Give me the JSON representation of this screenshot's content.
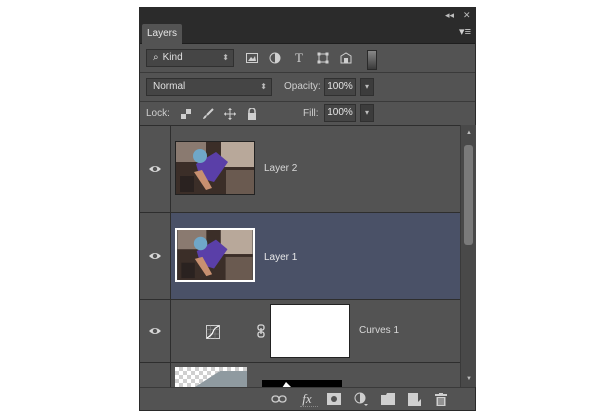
{
  "panel": {
    "tab_label": "Layers",
    "collapse_glyph": "◂◂",
    "close_glyph": "✕",
    "menu_glyph": "▾≡"
  },
  "filter": {
    "kind_label": "Kind",
    "search_glyph": "⌕",
    "arrow_glyph": "⬍",
    "filter_icons": [
      "image-filter-icon",
      "adjustment-filter-icon",
      "type-filter-icon",
      "shape-filter-icon",
      "smart-object-filter-icon",
      "filter-toggle-icon"
    ],
    "type_glyph": "T"
  },
  "blend": {
    "mode": "Normal",
    "arrow_glyph": "⬍",
    "opacity_label": "Opacity:",
    "opacity_value": "100%",
    "drop_glyph": "▾"
  },
  "lock": {
    "label": "Lock:",
    "icons": [
      "lock-transparent-pixels-icon",
      "lock-image-pixels-icon",
      "lock-position-icon",
      "lock-all-icon"
    ],
    "fill_label": "Fill:",
    "fill_value": "100%",
    "drop_glyph": "▾"
  },
  "layers": [
    {
      "name": "Layer 2",
      "selected": false,
      "visible": true,
      "type": "pixel"
    },
    {
      "name": "Layer 1",
      "selected": true,
      "visible": true,
      "type": "pixel"
    },
    {
      "name": "Curves 1",
      "selected": false,
      "visible": true,
      "type": "adjustment"
    },
    {
      "name": "",
      "selected": false,
      "visible": false,
      "type": "pixel-partial"
    }
  ],
  "scrollbar": {
    "up_glyph": "▲",
    "down_glyph": "▼"
  },
  "bottom_bar": {
    "fx_label": "fx",
    "icons": [
      "link-layers-icon",
      "layer-style-icon",
      "add-mask-icon",
      "new-adjustment-icon",
      "new-group-icon",
      "new-layer-icon",
      "delete-layer-icon"
    ]
  },
  "colors": {
    "panel_bg": "#535353",
    "selected_row": "#4a5167",
    "dark_strip": "#2b2b2b"
  }
}
